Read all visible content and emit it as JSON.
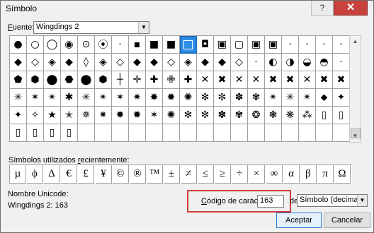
{
  "window": {
    "title": "Símbolo",
    "help_label": "?",
    "close_label": "✕"
  },
  "font": {
    "label_prefix": "",
    "label_underlined": "F",
    "label_rest": "uente:",
    "value": "Wingdings 2"
  },
  "grid": {
    "rows": [
      [
        "●",
        "○",
        "◯",
        "◉",
        "⊙",
        "⦿",
        "·",
        "▪",
        "■",
        "■",
        "▣",
        "◘",
        "▣",
        "▢",
        "▣",
        "▣",
        "·",
        "·",
        "·",
        "·"
      ],
      [
        "◆",
        "◇",
        "◈",
        "◆",
        "◊",
        "◈",
        "◇",
        "◆",
        "◆",
        "◇",
        "◈",
        "◆",
        "◆",
        "◇",
        "·",
        "◐",
        "◑",
        "◒",
        "◓",
        "·"
      ],
      [
        "⬟",
        "⬢",
        "⬤",
        "⬣",
        "⬤",
        "⬢",
        "┼",
        "✛",
        "✚",
        "✙",
        "✚",
        "✕",
        "✖",
        "✕",
        "✕",
        "✖",
        "✖",
        "✕",
        "✖",
        "✖"
      ],
      [
        "✳",
        "✶",
        "✴",
        "✱",
        "✳",
        "✴",
        "✶",
        "✷",
        "✸",
        "✹",
        "✺",
        "✻",
        "✼",
        "✽",
        "✾",
        "✴",
        "✳",
        "✴",
        "⬥",
        "✦"
      ],
      [
        "✦",
        "✧",
        "★",
        "✭",
        "✵",
        "✷",
        "✸",
        "✹",
        "✶",
        "✺",
        "✻",
        "✼",
        "✽",
        "✾",
        "❂",
        "❃",
        "❋",
        "⁂",
        "▯",
        "▯"
      ],
      [
        "▯",
        "▯",
        "▯",
        "▯",
        "",
        "",
        "",
        "",
        "",
        "",
        "",
        "",
        "",
        "",
        "",
        "",
        "",
        "",
        "",
        ""
      ]
    ],
    "selected_index": 10,
    "selected_icon": "white-square-icon"
  },
  "recent": {
    "label_prefix": "Símbolos utilizados ",
    "label_underlined": "r",
    "label_rest": "ecientemente:",
    "symbols": [
      "µ",
      "ϕ",
      "Δ",
      "€",
      "£",
      "¥",
      "©",
      "®",
      "™",
      "±",
      "≠",
      "≤",
      "≥",
      "÷",
      "×",
      "∞",
      "α",
      "β",
      "π",
      "Ω"
    ]
  },
  "unicode": {
    "name_label": "Nombre Unicode:",
    "value": "Wingdings 2: 163"
  },
  "code": {
    "label_underlined": "C",
    "label_rest": "ódigo de carácter:",
    "value": "163",
    "de_label": "de:",
    "from_value": "Símbolo (decimal)"
  },
  "buttons": {
    "accept": "Aceptar",
    "cancel": "Cancelar"
  }
}
